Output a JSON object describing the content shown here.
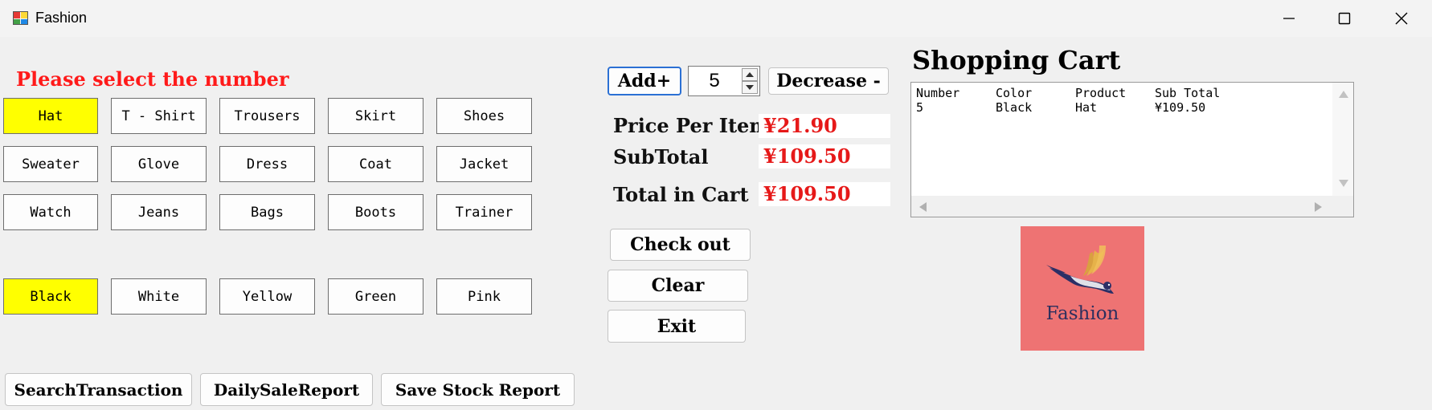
{
  "window": {
    "title": "Fashion",
    "controls": [
      "minimize",
      "maximize",
      "close"
    ]
  },
  "prompt": "Please select the number",
  "products": [
    "Hat",
    "T - Shirt",
    "Trousers",
    "Skirt",
    "Shoes",
    "Sweater",
    "Glove",
    "Dress",
    "Coat",
    "Jacket",
    "Watch",
    "Jeans",
    "Bags",
    "Boots",
    "Trainer"
  ],
  "selected_product": "Hat",
  "colors": [
    "Black",
    "White",
    "Yellow",
    "Green",
    "Pink"
  ],
  "selected_color": "Black",
  "quantity": {
    "add_label": "Add+",
    "value": "5",
    "decrease_label": "Decrease -"
  },
  "pricing": {
    "price_label": "Price Per Item",
    "price_value": "¥21.90",
    "subtotal_label": "SubTotal",
    "subtotal_value": "¥109.50",
    "total_label": "Total in Cart",
    "total_value": "¥109.50"
  },
  "actions": {
    "checkout": "Check out",
    "clear": "Clear",
    "exit": "Exit"
  },
  "reports": {
    "search": "SearchTransaction",
    "daily": "DailySaleReport",
    "stock": "Save Stock Report"
  },
  "cart": {
    "title": "Shopping Cart",
    "headers": [
      "Number",
      "Color",
      "Product",
      "Sub Total"
    ],
    "rows": [
      [
        "5",
        "Black",
        "Hat",
        "¥109.50"
      ]
    ]
  },
  "logo": {
    "text": "Fashion"
  },
  "accent_colors": {
    "selected": "#ffff00",
    "price_text": "#e61919",
    "heading": "#ff1a1a",
    "logo_bg": "#ee7373"
  }
}
